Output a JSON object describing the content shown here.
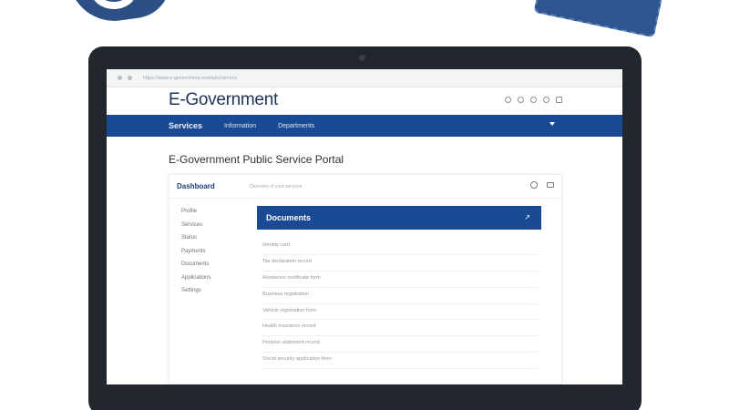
{
  "browser": {
    "url": "https://www.e-government.example/service"
  },
  "site": {
    "title": "E-Government",
    "header_icons": [
      "search-icon",
      "user-icon",
      "settings-icon",
      "notification-icon",
      "window-icon"
    ]
  },
  "nav": {
    "items": [
      {
        "label": "Services",
        "style": "bold"
      },
      {
        "label": "Information",
        "style": "light"
      },
      {
        "label": "Departments",
        "style": "light"
      }
    ]
  },
  "page": {
    "heading": "E-Government Public Service Portal"
  },
  "card": {
    "title": "Dashboard",
    "subtitle": "Overview of your services",
    "sidebar": [
      "Profile",
      "Services",
      "Status",
      "Payments",
      "Documents",
      "Applications",
      "Settings"
    ],
    "panel_title": "Documents",
    "rows": [
      "Identity card",
      "Tax declaration record",
      "Residence certificate form",
      "Business registration",
      "Vehicle registration form",
      "Health insurance record",
      "Pension statement record",
      "Social security application form"
    ]
  },
  "colors": {
    "primary": "#1a4a93",
    "frame": "#22262d",
    "title": "#1f3358"
  }
}
